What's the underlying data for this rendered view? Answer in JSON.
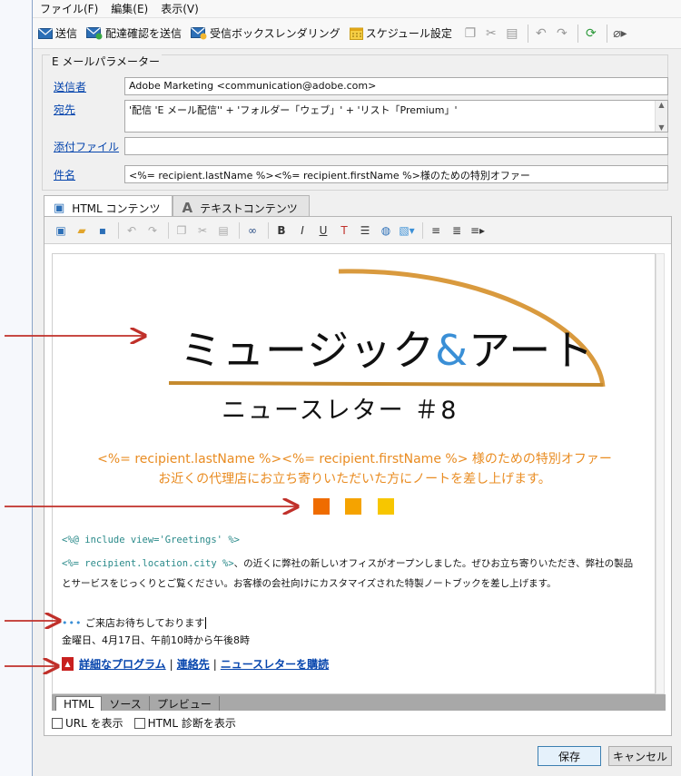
{
  "menu": [
    "ファイル(F)",
    "編集(E)",
    "表示(V)"
  ],
  "toolbar": {
    "send": "送信",
    "send_proof": "配達確認を送信",
    "inbox_rendering": "受信ボックスレンダリング",
    "schedule": "スケジュール設定"
  },
  "params": {
    "title": "E メールパラメーター",
    "sender_label": "送信者",
    "sender_value": "Adobe Marketing  <communication@adobe.com>",
    "to_label": "宛先",
    "to_value": "'配信 'E メール配信'' + 'フォルダー「ウェブ」' + 'リスト「Premium」'",
    "attach_label": "添付ファイル",
    "attach_value": "",
    "subject_label": "件名",
    "subject_value": "<%= recipient.lastName %><%= recipient.firstName %>様のための特別オファー"
  },
  "tabs": {
    "html": "HTML コンテンツ",
    "text": "テキストコンテンツ"
  },
  "editor": {
    "title_main": "ミュージック",
    "title_amp": "&",
    "title_tail": "アート",
    "subtitle": "ニュースレター ＃8",
    "offer_line1": "<%= recipient.lastName %><%= recipient.firstName %> 様のための特別オファー",
    "offer_line2": "お近くの代理店にお立ち寄りいただいた方にノートを差し上げます。",
    "include_line": "<%@ include view='Greetings' %>",
    "city_tag": "<%= recipient.location.city %>",
    "body_line1": "、の近くに弊社の新しいオフィスがオープンしました。ぜひお立ち寄りいただき、弊社の製品",
    "body_line2": "とサービスをじっくりとご覧ください。お客様の会社向けにカスタマイズされた特製ノートブックを差し上げます。",
    "dots": "•••",
    "welcome": " ご来店お待ちしております",
    "schedule": "金曜日、4月17日、午前10時から午後8時",
    "link_program": "詳細なプログラム",
    "link_contact": "連絡先",
    "link_subscribe": "ニュースレターを購読",
    "separator": "|"
  },
  "bottom_tabs": [
    "HTML",
    "ソース",
    "プレビュー"
  ],
  "checks": {
    "show_url": "URL を表示",
    "html_diag": "HTML 診断を表示"
  },
  "buttons": {
    "save": "保存",
    "cancel": "キャンセル"
  },
  "colors": {
    "orange": "#e98c22",
    "square1": "#ef6c00",
    "square2": "#f5a300",
    "square3": "#f7c600",
    "arrow": "#c0302a"
  }
}
